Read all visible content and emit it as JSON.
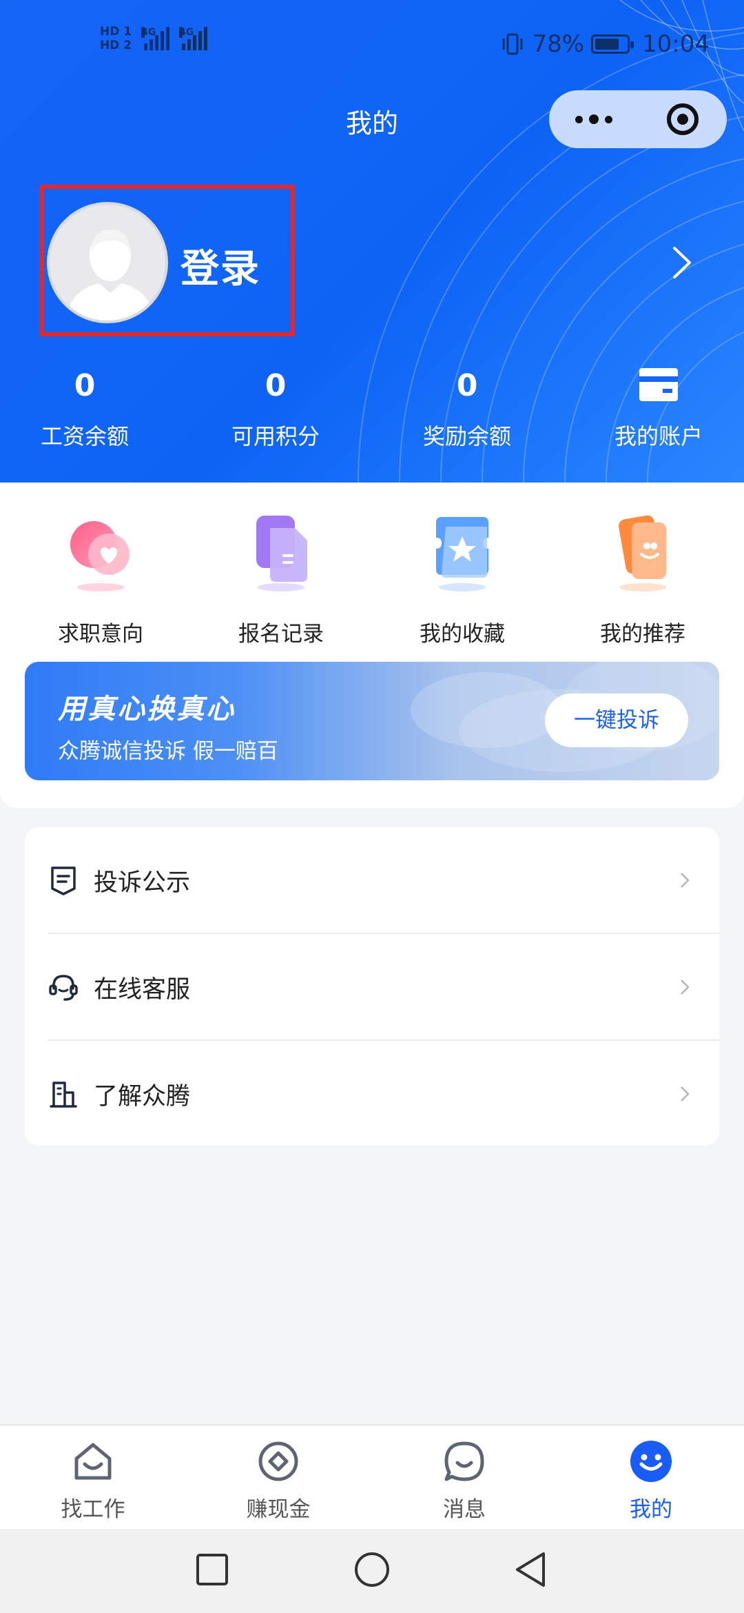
{
  "status_bar": {
    "hd1": "HD 1",
    "hd2": "HD 2",
    "net1": "4G",
    "net2": "4G",
    "battery_percent": "78%",
    "battery_level": 0.78,
    "time": "10:04"
  },
  "header": {
    "title": "我的",
    "capsule_menu_icon": "more-dots-icon",
    "capsule_close_icon": "target-icon",
    "accent_color": "#0e63f5"
  },
  "profile": {
    "login_label": "登录",
    "highlight_color": "#e5262b"
  },
  "stats": [
    {
      "value": "0",
      "label": "工资余额"
    },
    {
      "value": "0",
      "label": "可用积分"
    },
    {
      "value": "0",
      "label": "奖励余额"
    },
    {
      "icon": "wallet-card-icon",
      "label": "我的账户"
    }
  ],
  "quick_actions": [
    {
      "icon": "heart-icon",
      "label": "求职意向"
    },
    {
      "icon": "document-icon",
      "label": "报名记录"
    },
    {
      "icon": "star-ticket-icon",
      "label": "我的收藏"
    },
    {
      "icon": "recommend-card-icon",
      "label": "我的推荐"
    }
  ],
  "banner": {
    "title": "用真心换真心",
    "subtitle": "众腾诚信投诉  假一赔百",
    "button": "一键投诉"
  },
  "menu": [
    {
      "icon": "shield-icon",
      "label": "投诉公示"
    },
    {
      "icon": "headset-icon",
      "label": "在线客服"
    },
    {
      "icon": "building-icon",
      "label": "了解众腾"
    }
  ],
  "tabbar": [
    {
      "icon": "home-icon",
      "label": "找工作",
      "active": false
    },
    {
      "icon": "coin-icon",
      "label": "赚现金",
      "active": false
    },
    {
      "icon": "chat-icon",
      "label": "消息",
      "active": false
    },
    {
      "icon": "smiley-icon",
      "label": "我的",
      "active": true
    }
  ],
  "tab_active_color": "#1a5cf6"
}
